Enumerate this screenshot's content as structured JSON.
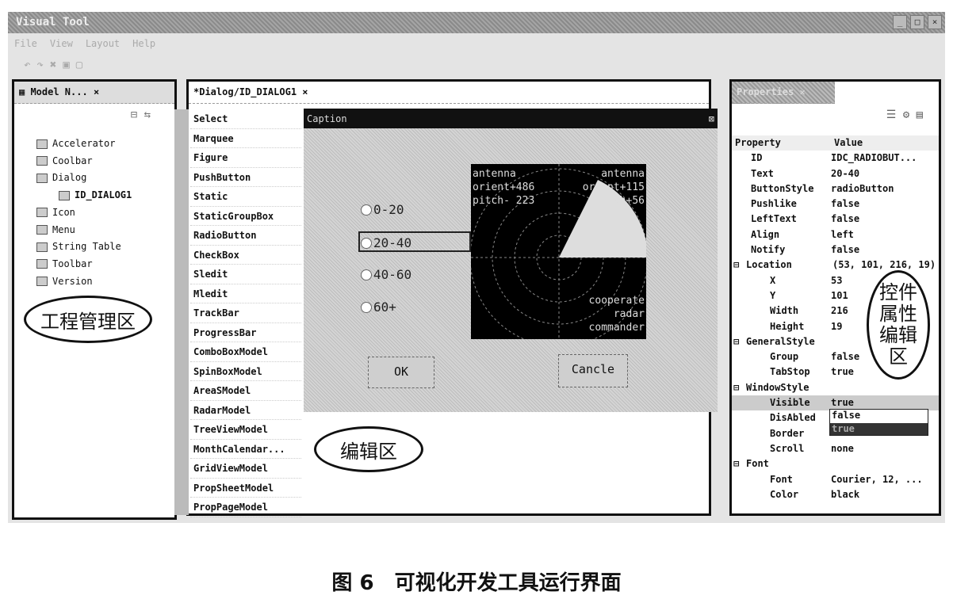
{
  "window": {
    "title": "Visual Tool",
    "controls": [
      "_",
      "□",
      "×"
    ]
  },
  "menu": [
    "File",
    "View",
    "Layout",
    "Help"
  ],
  "model_panel": {
    "tab": "Model N...",
    "items": [
      {
        "label": "Accelerator",
        "bold": false,
        "indent": 1
      },
      {
        "label": "Coolbar",
        "bold": false,
        "indent": 1
      },
      {
        "label": "Dialog",
        "bold": false,
        "indent": 1
      },
      {
        "label": "ID_DIALOG1",
        "bold": true,
        "indent": 2
      },
      {
        "label": "Icon",
        "bold": false,
        "indent": 1
      },
      {
        "label": "Menu",
        "bold": false,
        "indent": 1
      },
      {
        "label": "String Table",
        "bold": false,
        "indent": 1
      },
      {
        "label": "Toolbar",
        "bold": false,
        "indent": 1
      },
      {
        "label": "Version",
        "bold": false,
        "indent": 1
      }
    ],
    "annotation": "工程管理区"
  },
  "editor": {
    "tab": "*Dialog/ID_DIALOG1",
    "annotation": "编辑区",
    "palette": [
      "Select",
      "Marquee",
      "Figure",
      "PushButton",
      "Static",
      "StaticGroupBox",
      "RadioButton",
      "CheckBox",
      "Sledit",
      "Mledit",
      "TrackBar",
      "ProgressBar",
      "ComboBoxModel",
      "SpinBoxModel",
      "AreaSModel",
      "RadarModel",
      "TreeViewModel",
      "MonthCalendar...",
      "GridViewModel",
      "PropSheetModel",
      "PropPageModel"
    ],
    "dialog": {
      "caption": "Caption",
      "radios": [
        "0-20",
        "20-40",
        "40-60",
        "60+"
      ],
      "selected_radio": "20-40",
      "ok": "OK",
      "cancel": "Cancle",
      "radar": {
        "left": "antenna\norient+486\npitch- 223",
        "right": "antenna\norient+115\npitch+56",
        "bottom": "cooperate\nradar\ncommander"
      }
    }
  },
  "properties": {
    "tab": "Properties",
    "header": [
      "Property",
      "Value"
    ],
    "annotation": "控件属性编辑区",
    "rows": [
      {
        "k": "ID",
        "v": "IDC_RADIOBUT...",
        "lvl": 1
      },
      {
        "k": "Text",
        "v": "20-40",
        "lvl": 1
      },
      {
        "k": "ButtonStyle",
        "v": "radioButton",
        "lvl": 1
      },
      {
        "k": "Pushlike",
        "v": "false",
        "lvl": 1
      },
      {
        "k": "LeftText",
        "v": "false",
        "lvl": 1
      },
      {
        "k": "Align",
        "v": "left",
        "lvl": 1
      },
      {
        "k": "Notify",
        "v": "false",
        "lvl": 1
      },
      {
        "k": "Location",
        "v": "(53, 101, 216, 19)",
        "lvl": 0
      },
      {
        "k": "X",
        "v": "53",
        "lvl": 2
      },
      {
        "k": "Y",
        "v": "101",
        "lvl": 2
      },
      {
        "k": "Width",
        "v": "216",
        "lvl": 2
      },
      {
        "k": "Height",
        "v": "19",
        "lvl": 2
      },
      {
        "k": "GeneralStyle",
        "v": "",
        "lvl": 0
      },
      {
        "k": "Group",
        "v": "false",
        "lvl": 2
      },
      {
        "k": "TabStop",
        "v": "true",
        "lvl": 2
      },
      {
        "k": "WindowStyle",
        "v": "",
        "lvl": 0
      },
      {
        "k": "Visible",
        "v": "true",
        "lvl": 2
      },
      {
        "k": "DisAbled",
        "v": "false",
        "lvl": 2
      },
      {
        "k": "Border",
        "v": "",
        "lvl": 2
      },
      {
        "k": "Scroll",
        "v": "none",
        "lvl": 2
      },
      {
        "k": "Font",
        "v": "",
        "lvl": 0
      },
      {
        "k": "Font",
        "v": "Courier, 12, ...",
        "lvl": 2
      },
      {
        "k": "Color",
        "v": "black",
        "lvl": 2
      }
    ],
    "dropdown_options": [
      "false",
      "true"
    ]
  },
  "figure_caption": "图 6　可视化开发工具运行界面"
}
